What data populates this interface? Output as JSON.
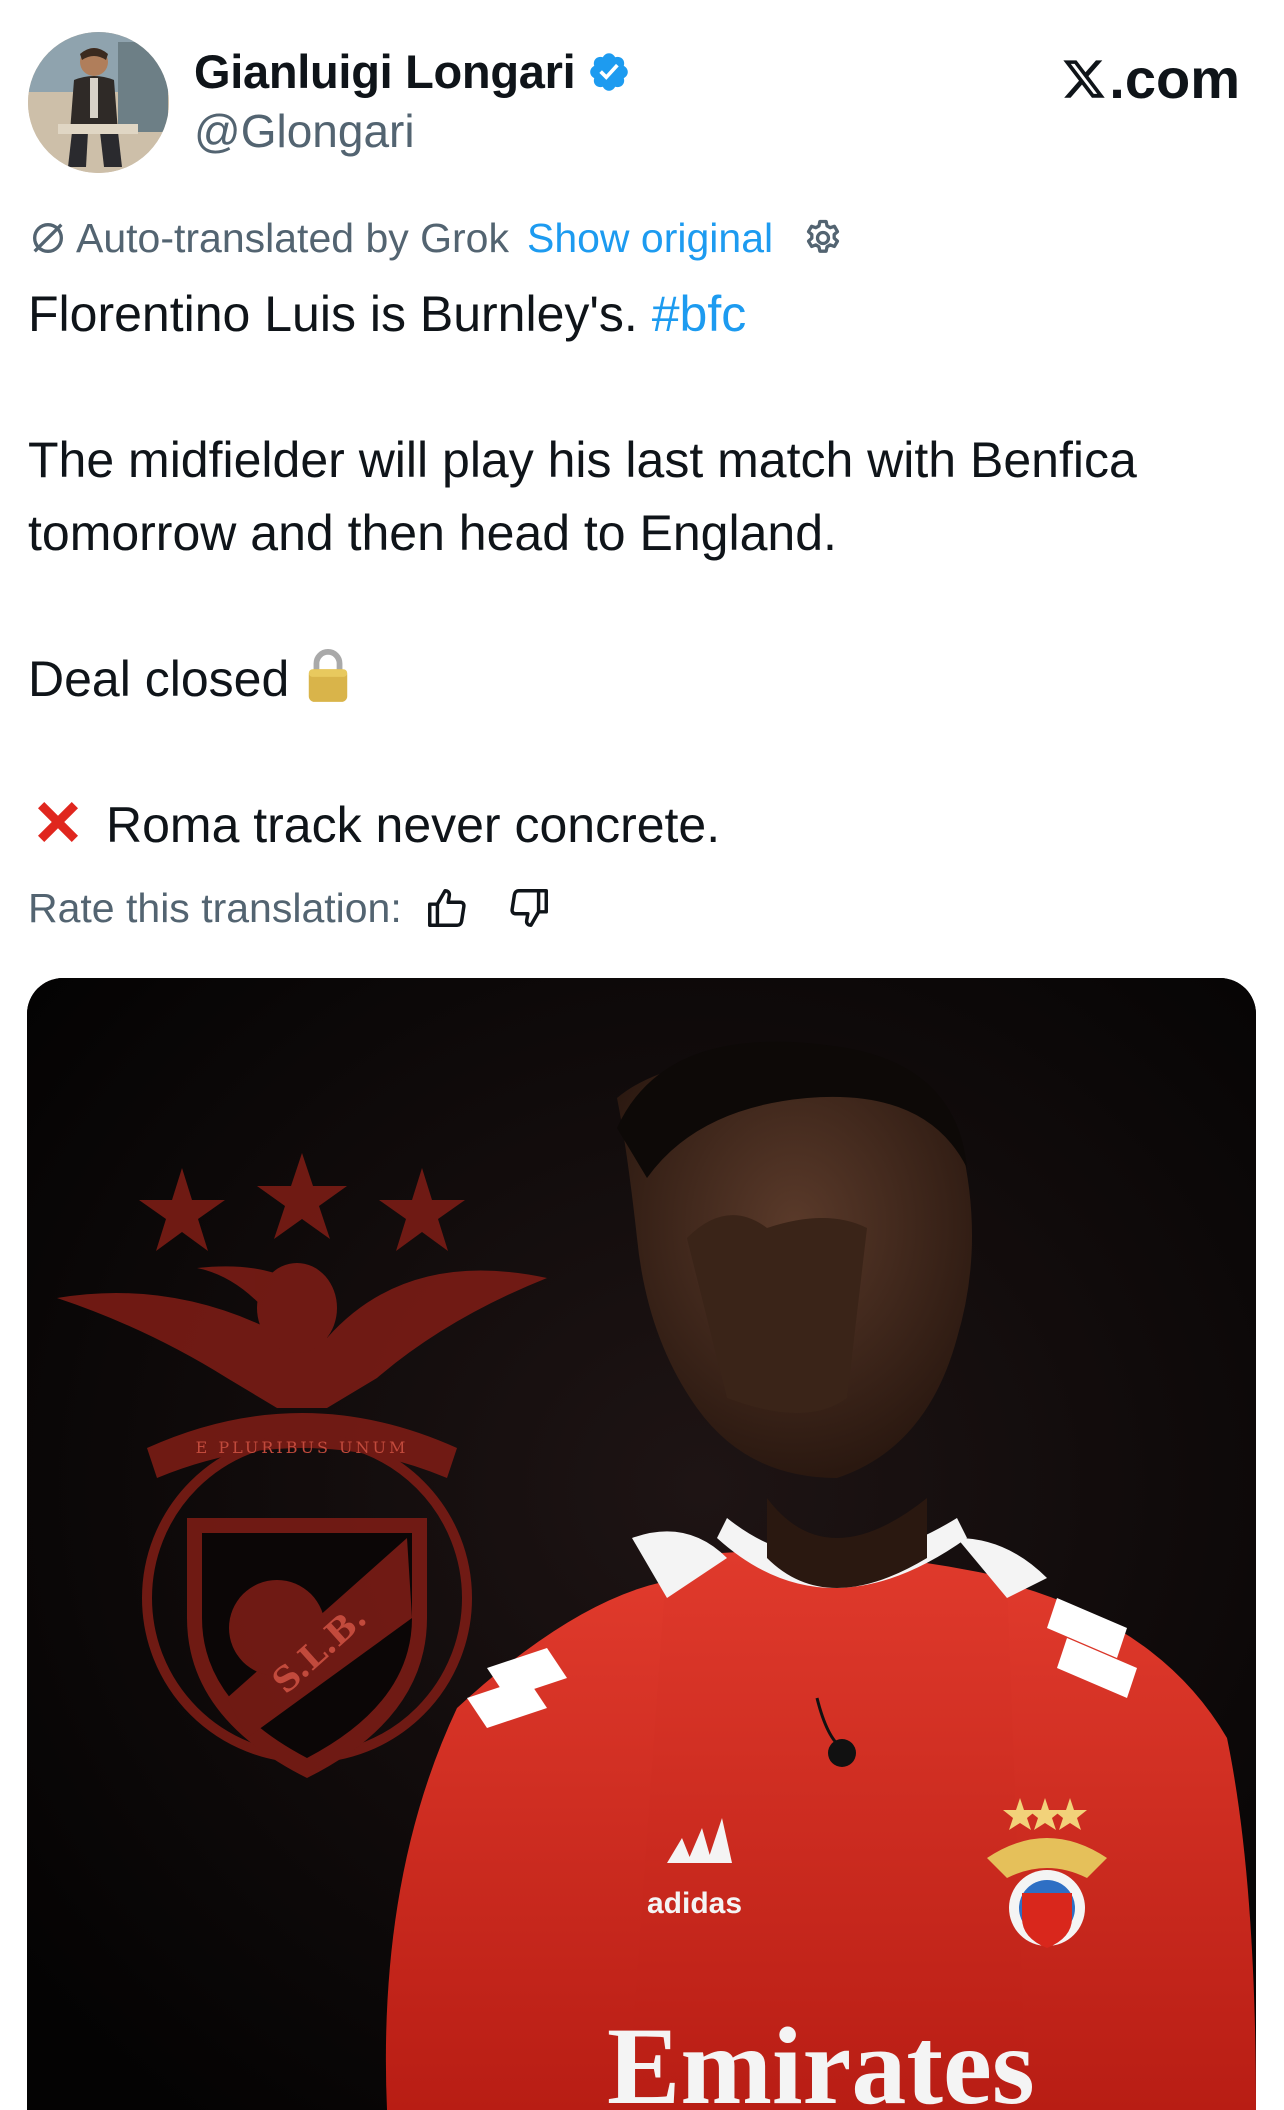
{
  "author": {
    "name": "Gianluigi Longari",
    "handle": "@Glongari",
    "verified": true,
    "verified_color": "#1d9bf0"
  },
  "brand": {
    "text": ".com",
    "icon": "x-logo-icon"
  },
  "translation": {
    "label": "Auto-translated by Grok",
    "show_original": "Show original",
    "rate_label": "Rate this translation:"
  },
  "tweet": {
    "line1_text": "Florentino Luis is Burnley's. ",
    "hashtag": "#bfc",
    "line2": "The midfielder will play his last match with Benfica tomorrow and then head to England.",
    "line3": "Deal closed",
    "line3_icon": "lock-icon",
    "line4_icon": "cross-mark-icon",
    "line4": "Roma track never concrete."
  },
  "media": {
    "crest_motto": "E PLURIBUS UNUM",
    "crest_letters": "S.L.B.",
    "shirt_brand": "adidas",
    "shirt_sponsor": "Emirates"
  },
  "colors": {
    "text": "#0f1419",
    "secondary": "#536471",
    "link": "#1d9bf0",
    "benfica_red": "#d9271c",
    "crest_red": "#8a1f17"
  }
}
